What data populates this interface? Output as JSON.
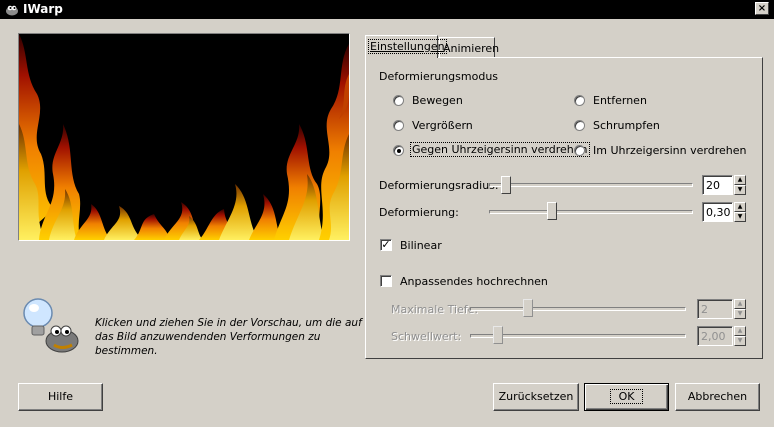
{
  "window": {
    "title": "IWarp",
    "close_label": "×"
  },
  "tabs": [
    {
      "label": "Einstellungen",
      "underline": "E",
      "active": true
    },
    {
      "label": "Animieren",
      "underline": "A",
      "active": false
    }
  ],
  "settings": {
    "mode_heading": "Deformierungsmodus",
    "modes": [
      {
        "label": "Bewegen",
        "checked": false
      },
      {
        "label": "Entfernen",
        "checked": false
      },
      {
        "label": "Vergrößern",
        "checked": false
      },
      {
        "label": "Schrumpfen",
        "checked": false
      },
      {
        "label": "Gegen Uhrzeigersinn verdrehen",
        "checked": true
      },
      {
        "label": "Im Uhrzeigersinn verdrehen",
        "checked": false
      }
    ],
    "radius": {
      "label": "Deformierungsradius:",
      "value": "20",
      "level": 0.1
    },
    "amount": {
      "label": "Deformierung:",
      "value": "0,30",
      "level": 0.3
    },
    "bilinear": {
      "label": "Bilinear",
      "checked": true
    },
    "supersample": {
      "label": "Anpassendes hochrechnen",
      "checked": false
    },
    "max_depth": {
      "label": "Maximale Tiefe:",
      "value": "2",
      "level": 0.25
    },
    "threshold": {
      "label": "Schwellwert:",
      "value": "2,00",
      "level": 0.13
    }
  },
  "hint": {
    "line1": "Klicken und ziehen Sie in der Vorschau, um die auf",
    "line2": "das Bild anzuwendenden Verformungen zu bestimmen."
  },
  "buttons": {
    "help": "Hilfe",
    "reset": "Zurücksetzen",
    "ok": "OK",
    "cancel": "Abbrechen"
  },
  "colors": {
    "titlebar": "#000000",
    "dialog": "#d4d0c8",
    "flame_yellow": "#ffe000",
    "flame_red": "#c01000"
  }
}
